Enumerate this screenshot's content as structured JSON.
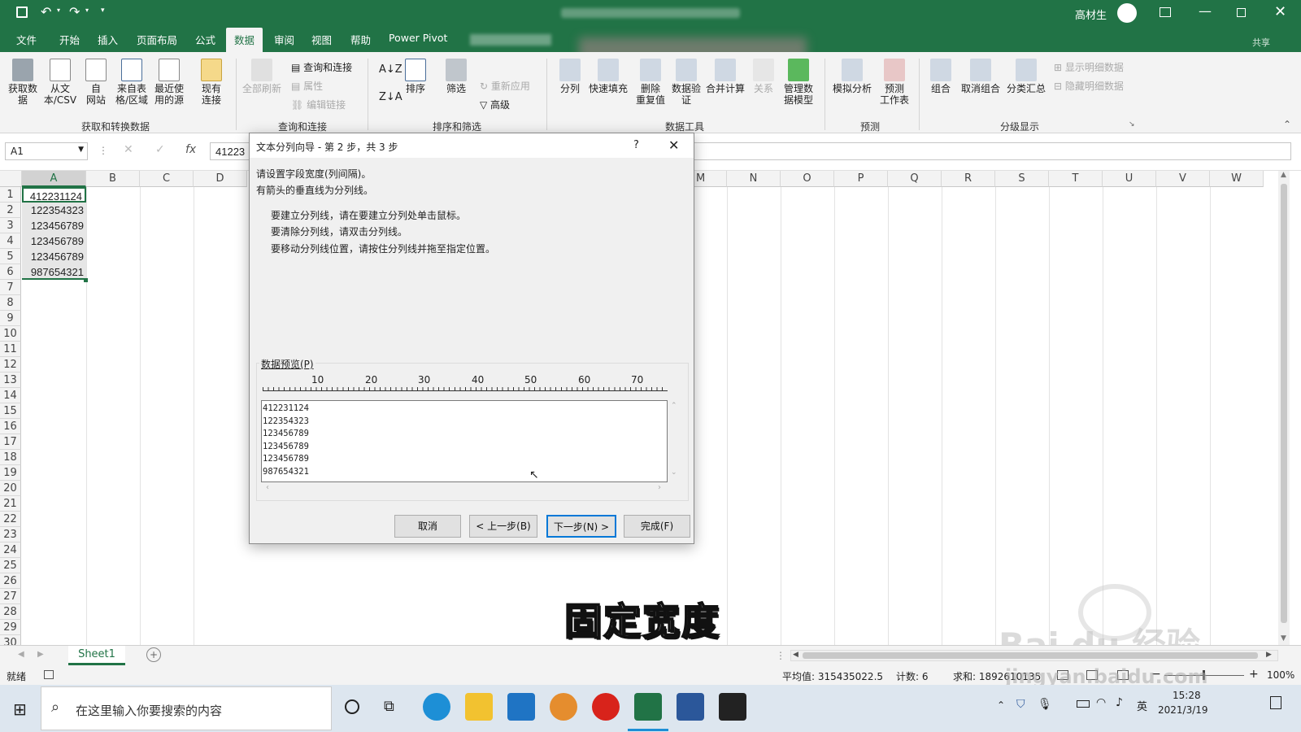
{
  "titlebar": {
    "user": "高材生"
  },
  "menu": {
    "tabs": [
      "文件",
      "开始",
      "插入",
      "页面布局",
      "公式",
      "数据",
      "审阅",
      "视图",
      "帮助",
      "Power Pivot"
    ],
    "active": "数据",
    "share": "共享"
  },
  "ribbon": {
    "get_data": "获取数\n据",
    "from_text": "从文\n本/CSV",
    "from_web": "自\n网站",
    "from_table": "来自表\n格/区域",
    "recent_sources": "最近使\n用的源",
    "existing_conn": "现有\n连接",
    "group_get": "获取和转换数据",
    "refresh_all": "全部刷新",
    "queries_conn": "查询和连接",
    "properties": "属性",
    "edit_links": "编辑链接",
    "group_queries": "查询和连接",
    "sort": "排序",
    "filter": "筛选",
    "reapply": "重新应用",
    "advanced": "高级",
    "group_sort": "排序和筛选",
    "text_to_cols": "分列",
    "flash_fill": "快速填充",
    "remove_dup": "删除\n重复值",
    "data_valid": "数据验\n证",
    "consolidate": "合并计算",
    "relations": "关系",
    "manage_model": "管理数\n据模型",
    "group_tools": "数据工具",
    "what_if": "模拟分析",
    "forecast": "预测\n工作表",
    "group_forecast": "预测",
    "group_btn": "组合",
    "ungroup": "取消组合",
    "subtotal": "分类汇总",
    "show_detail": "显示明细数据",
    "hide_detail": "隐藏明细数据",
    "group_outline": "分级显示"
  },
  "formula": {
    "namebox": "A1",
    "content": "41223"
  },
  "columns": [
    "A",
    "B",
    "C",
    "D",
    "M",
    "N",
    "O",
    "P",
    "Q",
    "R",
    "S",
    "T",
    "U",
    "V",
    "W"
  ],
  "rows": [
    "1",
    "2",
    "3",
    "4",
    "5",
    "6",
    "7",
    "8",
    "9",
    "10",
    "11",
    "12",
    "13",
    "14",
    "15",
    "16",
    "17",
    "18",
    "19",
    "20",
    "21",
    "22",
    "23",
    "24",
    "25",
    "26",
    "27",
    "28",
    "29",
    "30"
  ],
  "cells": [
    "412231124",
    "122354323",
    "123456789",
    "123456789",
    "123456789",
    "987654321"
  ],
  "dialog": {
    "title": "文本分列向导 - 第 2 步，共 3 步",
    "help": "?",
    "line1": "请设置字段宽度(列间隔)。",
    "line2": "有箭头的垂直线为分列线。",
    "instr1": "要建立分列线，请在要建立分列处单击鼠标。",
    "instr2": "要清除分列线，请双击分列线。",
    "instr3": "要移动分列线位置，请按住分列线并拖至指定位置。",
    "preview_label": "数据预览(P)",
    "ruler": [
      "10",
      "20",
      "30",
      "40",
      "50",
      "60",
      "70"
    ],
    "preview_lines": [
      "412231124",
      "122354323",
      "123456789",
      "123456789",
      "123456789",
      "987654321"
    ],
    "cancel": "取消",
    "back": "< 上一步(B)",
    "next": "下一步(N) >",
    "finish": "完成(F)"
  },
  "caption": "固定宽度",
  "watermark": "Bai du 经验",
  "watermark_url": "jingyan.baidu.com",
  "sheet": {
    "name": "Sheet1"
  },
  "status": {
    "ready": "就绪",
    "average": "平均值: 315435022.5",
    "count": "计数: 6",
    "sum": "求和: 1892610135",
    "zoom": "100%"
  },
  "taskbar": {
    "search": "在这里输入你要搜索的内容",
    "time": "15:28",
    "date": "2021/3/19",
    "ime": "英"
  },
  "colors": {
    "excel_green": "#217346",
    "accent": "#0078d7"
  }
}
